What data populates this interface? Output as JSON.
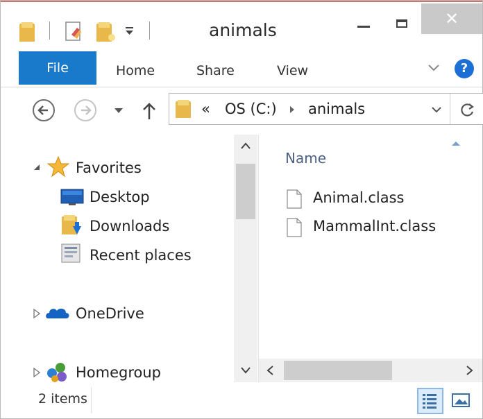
{
  "window": {
    "title": "animals",
    "close_glyph": "✕"
  },
  "ribbon": {
    "file": "File",
    "tabs": [
      "Home",
      "Share",
      "View"
    ],
    "help_glyph": "?"
  },
  "address": {
    "overflow": "«",
    "crumbs": [
      "OS (C:)",
      "animals"
    ]
  },
  "nav": {
    "favorites": "Favorites",
    "favorites_items": [
      "Desktop",
      "Downloads",
      "Recent places"
    ],
    "onedrive": "OneDrive",
    "homegroup": "Homegroup"
  },
  "content": {
    "column_name": "Name",
    "files": [
      "Animal.class",
      "MammalInt.class"
    ]
  },
  "status": {
    "item_count": "2 items"
  },
  "colors": {
    "accent": "#1979ca",
    "folder": "#e8b84a",
    "close_bg": "#c9c9c9"
  }
}
